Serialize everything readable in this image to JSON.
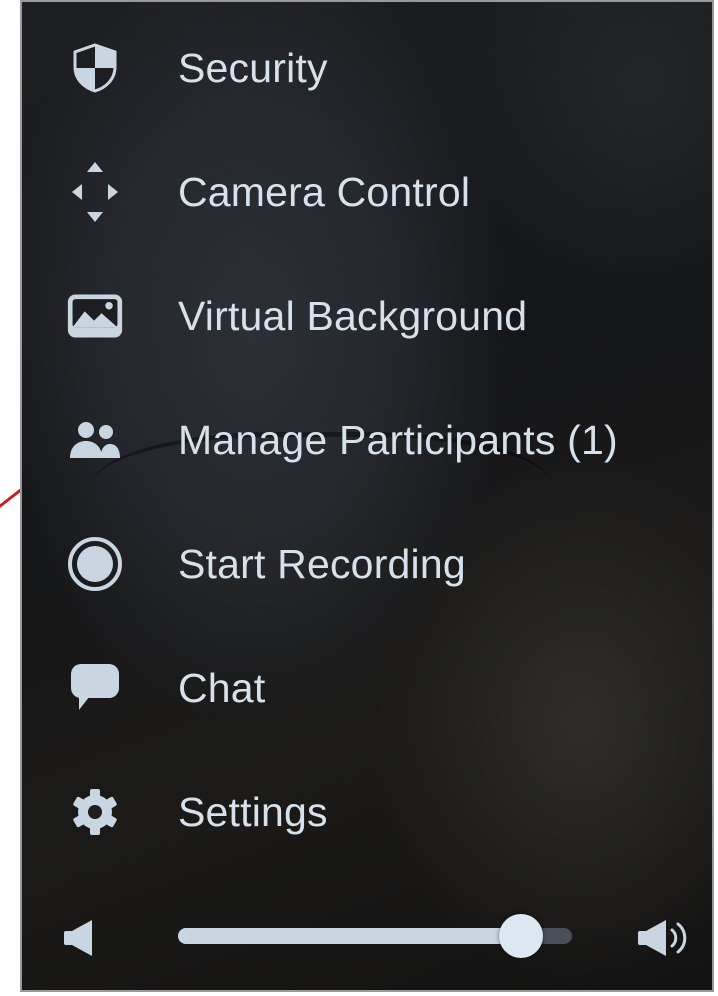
{
  "menu": {
    "items": [
      {
        "label": "Security",
        "icon": "shield-icon"
      },
      {
        "label": "Camera Control",
        "icon": "move-arrows-icon"
      },
      {
        "label": "Virtual Background",
        "icon": "image-icon"
      },
      {
        "label": "Manage Participants (1)",
        "icon": "participants-icon"
      },
      {
        "label": "Start Recording",
        "icon": "record-icon"
      },
      {
        "label": "Chat",
        "icon": "chat-bubble-icon"
      },
      {
        "label": "Settings",
        "icon": "gear-icon"
      }
    ]
  },
  "volume": {
    "level": 0.87,
    "low_icon": "volume-low-icon",
    "high_icon": "volume-high-icon"
  },
  "colors": {
    "text": "#d6e1ec",
    "icon": "#c9d6e2",
    "annotation": "#c81e1e",
    "border": "#9a9a9a"
  }
}
